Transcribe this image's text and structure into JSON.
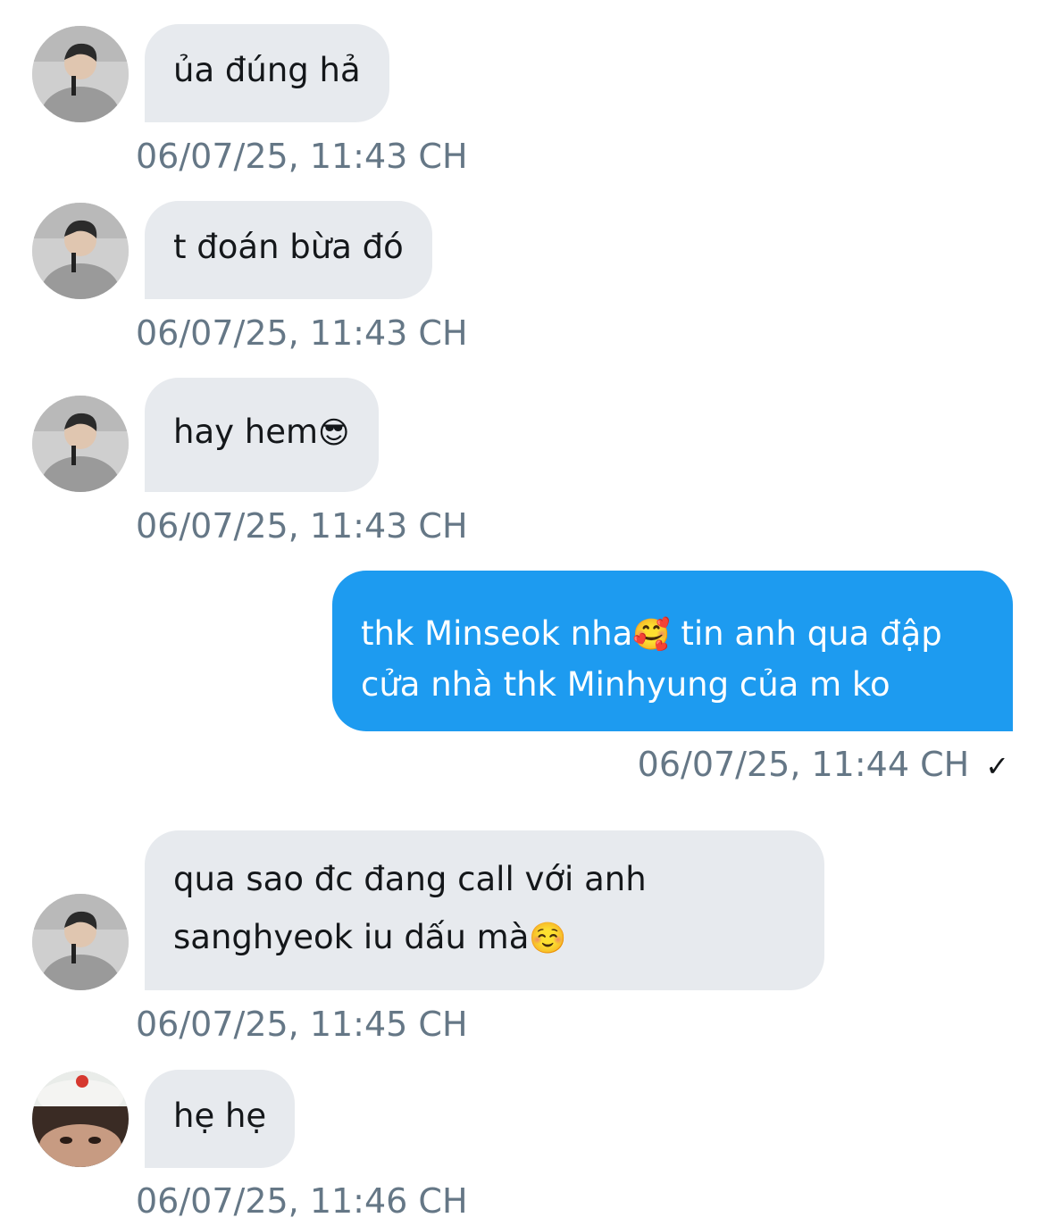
{
  "messages": [
    {
      "text": "ủa đúng hả",
      "timestamp": "06/07/25, 11:43 CH"
    },
    {
      "text": "t đoán bừa đó",
      "timestamp": "06/07/25, 11:43 CH"
    },
    {
      "text": "hay hem",
      "emoji": "😎",
      "timestamp": "06/07/25, 11:43 CH"
    },
    {
      "line1": "thk Minseok nha",
      "emoji": "🥰",
      "line1_rest": "tin anh qua đập",
      "line2": "cửa nhà thk Minhyung của m ko",
      "timestamp": "06/07/25, 11:44 CH",
      "status": "✓"
    },
    {
      "line1": "qua sao đc đang call với anh",
      "line2": "sanghyeok iu dấu mà",
      "emoji": "☺️",
      "timestamp": "06/07/25, 11:45 CH"
    },
    {
      "text": "hẹ hẹ",
      "timestamp": "06/07/25, 11:46 CH"
    }
  ],
  "colors": {
    "incoming_bubble": "#e7eaee",
    "outgoing_bubble": "#1d9bf0",
    "timestamp": "#657786"
  }
}
